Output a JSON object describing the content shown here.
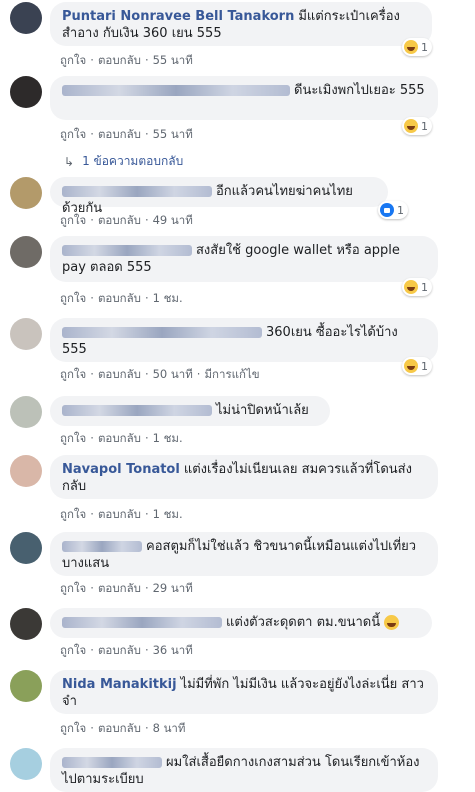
{
  "actions": {
    "like": "ถูกใจ",
    "reply": "ตอบกลับ",
    "edited": "มีการแก้ไข"
  },
  "view_replies": "1 ข้อความตอบกลับ",
  "comments": [
    {
      "author": "Puntari Nonravee Bell Tanakorn",
      "text": "มีแต่กระเป๋าเครื่องสำอาง กับเงิน 360 เยน 555",
      "time": "55 นาที",
      "reaction": "haha",
      "reaction_count": "1"
    },
    {
      "author": "",
      "text": "ดีนะเมิงพกไปเยอะ 555",
      "time": "55 นาที",
      "reaction": "haha",
      "reaction_count": "1"
    },
    {
      "author": "",
      "text": "อีกแล้วคนไทยฆ่าคนไทยด้วยกัน",
      "time": "49 นาที",
      "reaction": "like",
      "reaction_count": "1"
    },
    {
      "author": "",
      "text": "สงสัยใช้ google wallet หรือ apple pay ตลอด 555",
      "time": "1 ชม.",
      "reaction": "haha",
      "reaction_count": "1"
    },
    {
      "author": "",
      "text": "360เยน ซื้ออะไรได้บ้าง 555",
      "time": "50 นาที",
      "reaction": "haha",
      "reaction_count": "1"
    },
    {
      "author": "",
      "text": "ไม่น่าปิดหน้าเล้ย",
      "time": "1 ชม."
    },
    {
      "author": "Navapol Tonatol",
      "text": "แต่งเรื่องไม่เนียนเลย สมควรแล้วที่โดนส่งกลับ",
      "time": "1 ชม."
    },
    {
      "author": "",
      "text": "คอสตูมก็ไม่ใช่แล้ว ชิวขนาดนี้เหมือนแต่งไปเที่ยวบางแสน",
      "time": "29 นาที"
    },
    {
      "author": "",
      "text": "แต่งตัวสะดุดตา ตม.ขนาดนี้",
      "time": "36 นาที"
    },
    {
      "author": "Nida Manakitkij",
      "text": "ไม่มีที่พัก ไม่มีเงิน แล้วจะอยู่ยังไงล่ะเนี่ย สาวจ๋า",
      "time": "8 นาที"
    },
    {
      "author": "",
      "text": "ผมใส่เสื้อยืดกางเกงสามส่วน โดนเรียกเข้าห้องไปตามระเบียบ"
    }
  ]
}
